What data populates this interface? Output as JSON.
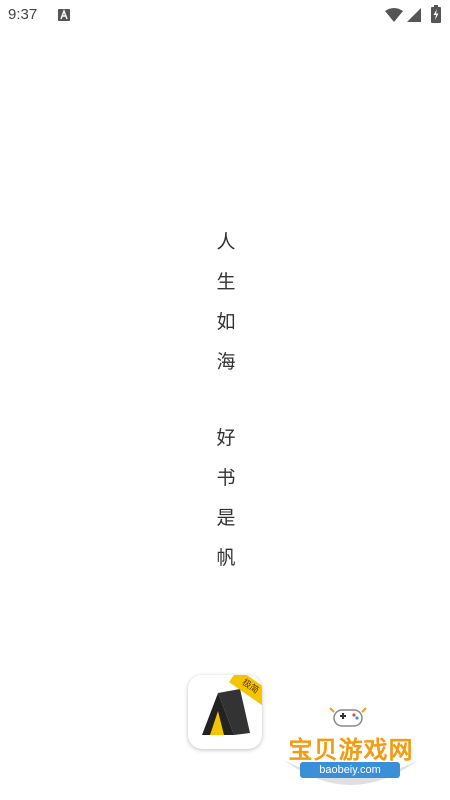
{
  "status_bar": {
    "time": "9:37",
    "notification_icon": "font-a-icon",
    "wifi_icon": "wifi-icon",
    "signal_icon": "cell-signal-icon",
    "battery_icon": "battery-charging-icon"
  },
  "slogan": {
    "line1": [
      "人",
      "生",
      "如",
      "海"
    ],
    "line2": [
      "好",
      "书",
      "是",
      "帆"
    ]
  },
  "app_logo": {
    "icon": "book-tent-icon",
    "badge": "极简",
    "accent_color": "#f5c400"
  },
  "watermark": {
    "title": "宝贝游戏网",
    "url": "baobeiy.com",
    "icon": "gamepad-icon"
  }
}
